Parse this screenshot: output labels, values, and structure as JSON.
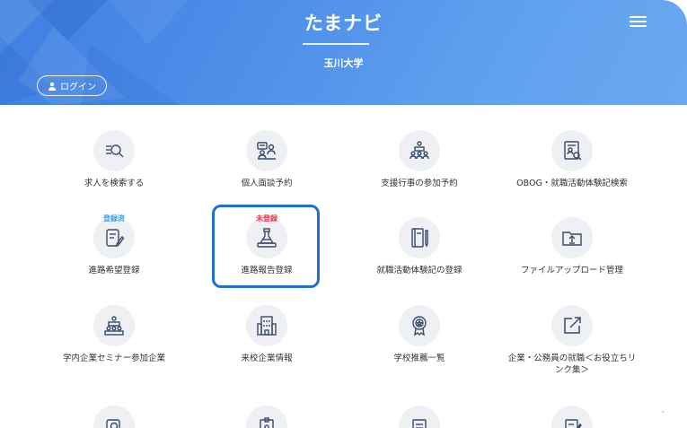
{
  "header": {
    "app_title": "たまナビ",
    "school": "玉川大学",
    "login_label": "ログイン"
  },
  "tiles": [
    {
      "label": "求人を検索する",
      "icon": "search-list-icon"
    },
    {
      "label": "個人面談予約",
      "icon": "consultation-icon"
    },
    {
      "label": "支援行事の参加予約",
      "icon": "seminar-icon"
    },
    {
      "label": "OBOG・就職活動体験記検索",
      "icon": "profile-search-icon"
    },
    {
      "label": "進路希望登録",
      "icon": "note-edit-icon",
      "badge": "登録済"
    },
    {
      "label": "進路報告登録",
      "icon": "report-flask-icon",
      "badge": "未登録"
    },
    {
      "label": "就職活動体験記の登録",
      "icon": "notebook-pen-icon"
    },
    {
      "label": "ファイルアップロード管理",
      "icon": "folder-upload-icon"
    },
    {
      "label": "学内企業セミナー参加企業",
      "icon": "company-seminar-icon"
    },
    {
      "label": "来校企業情報",
      "icon": "building-icon"
    },
    {
      "label": "学校推薦一覧",
      "icon": "award-badge-icon"
    },
    {
      "label": "企業・公務員の就職＜お役立ちリンク集＞",
      "icon": "external-link-icon"
    }
  ],
  "colors": {
    "header_gradient_start": "#3f7fe0",
    "header_gradient_end": "#6aa8f0",
    "icon_stroke": "#3a4a6b",
    "icon_bg": "#eef0f4",
    "badge_done": "#3aa0e8",
    "badge_pending": "#e8344f",
    "highlight": "#1f6fd6"
  }
}
